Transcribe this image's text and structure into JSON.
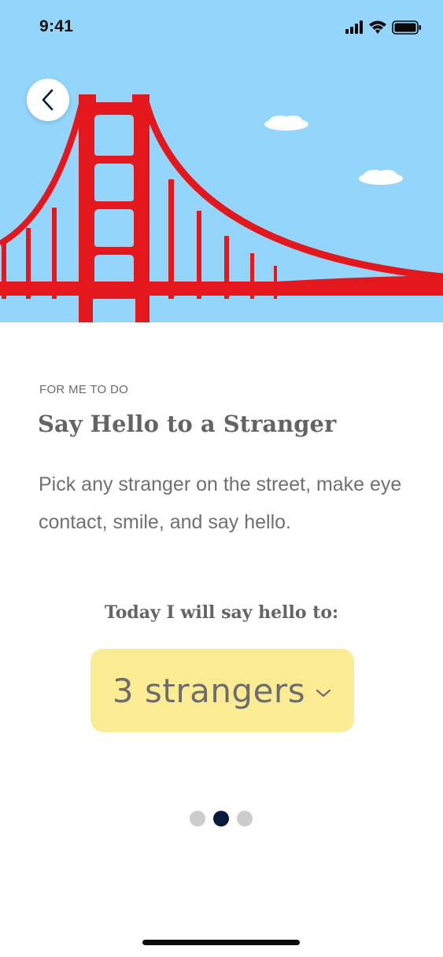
{
  "status_bar": {
    "time": "9:41",
    "icons": [
      "signal-icon",
      "wifi-icon",
      "battery-icon"
    ]
  },
  "hero": {
    "illustration": "golden-gate-bridge",
    "sky_color": "#94d6fb",
    "bridge_color": "#e3171c"
  },
  "header": {
    "back_icon": "chevron-left-icon"
  },
  "content": {
    "eyebrow": "FOR ME TO DO",
    "title": "Say Hello to a Stranger",
    "description": "Pick any stranger on the street, make eye contact, smile, and say hello.",
    "prompt": "Today I will say hello to:",
    "picker": {
      "value": "3 strangers",
      "icon": "chevron-down-icon",
      "background": "#fbec94"
    }
  },
  "pagination": {
    "total": 3,
    "active": 2,
    "active_color": "#0b1a3a",
    "inactive_color": "#cccccc"
  }
}
